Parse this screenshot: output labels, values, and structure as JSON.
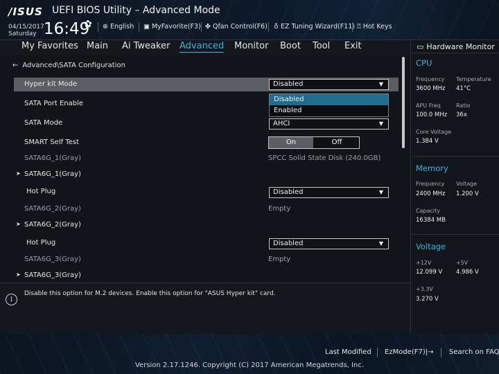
{
  "header": {
    "logo": "/ISUS",
    "title": "UEFI BIOS Utility – Advanced Mode",
    "date": "04/15/2017",
    "day": "Saturday",
    "time": "16:49",
    "tools": [
      {
        "icon": "globe-icon",
        "label": "English"
      },
      {
        "icon": "star-icon",
        "label": "MyFavorite(F3)"
      },
      {
        "icon": "fan-icon",
        "label": "Qfan Control(F6)"
      },
      {
        "icon": "bulb-icon",
        "label": "EZ Tuning Wizard(F11)"
      },
      {
        "icon": "question-icon",
        "label": "Hot Keys"
      }
    ]
  },
  "menu": {
    "tabs": [
      "My Favorites",
      "Main",
      "Ai Tweaker",
      "Advanced",
      "Monitor",
      "Boot",
      "Tool",
      "Exit"
    ],
    "active": "Advanced"
  },
  "breadcrumb": "Advanced\\SATA Configuration",
  "settings": {
    "hyper_kit": {
      "label": "Hyper kit Mode",
      "value": "Disabled"
    },
    "sata_port_enable": {
      "label": "SATA Port Enable"
    },
    "sata_mode": {
      "label": "SATA Mode",
      "value": "AHCI"
    },
    "smart_self_test": {
      "label": "SMART Self Test",
      "on": "On",
      "off": "Off"
    },
    "sata6g_1_info": {
      "label": "SATA6G_1(Gray)",
      "value": "SPCC Solid State Disk (240.0GB)"
    },
    "sata6g_1_sub": {
      "label": "SATA6G_1(Gray)"
    },
    "hot_plug_1": {
      "label": "Hot Plug",
      "value": "Disabled"
    },
    "sata6g_2_info": {
      "label": "SATA6G_2(Gray)",
      "value": "Empty"
    },
    "sata6g_2_sub": {
      "label": "SATA6G_2(Gray)"
    },
    "hot_plug_2": {
      "label": "Hot Plug",
      "value": "Disabled"
    },
    "sata6g_3_info": {
      "label": "SATA6G_3(Gray)",
      "value": "Empty"
    },
    "sata6g_3_sub": {
      "label": "SATA6G_3(Gray)"
    }
  },
  "dropdown_popup": {
    "options": [
      "Disabled",
      "Enabled"
    ],
    "selected": "Disabled"
  },
  "help": {
    "text": "Disable this option for M.2 devices. Enable this option for \"ASUS Hyper kit\" card."
  },
  "hardware_monitor": {
    "title": "Hardware Monitor",
    "cpu": {
      "heading": "CPU",
      "frequency_label": "Frequency",
      "frequency": "3600 MHz",
      "temperature_label": "Temperature",
      "temperature": "41°C",
      "apu_freq_label": "APU Freq",
      "apu_freq": "100.0 MHz",
      "ratio_label": "Ratio",
      "ratio": "36x",
      "core_voltage_label": "Core Voltage",
      "core_voltage": "1.384 V"
    },
    "memory": {
      "heading": "Memory",
      "frequency_label": "Frequency",
      "frequency": "2400 MHz",
      "voltage_label": "Voltage",
      "voltage": "1.200 V",
      "capacity_label": "Capacity",
      "capacity": "16384 MB"
    },
    "voltage": {
      "heading": "Voltage",
      "v12_label": "+12V",
      "v12": "12.099 V",
      "v5_label": "+5V",
      "v5": "4.986 V",
      "v33_label": "+3.3V",
      "v33": "3.270 V"
    }
  },
  "footer": {
    "last_modified": "Last Modified",
    "ezmode": "EzMode(F7)|→",
    "search_faq": "Search on FAQ",
    "copyright": "Version 2.17.1246. Copyright (C) 2017 American Megatrends, Inc."
  },
  "colors": {
    "accent": "#3cb4e6",
    "highlight_row": "#5a5e63",
    "popup_selected": "#1f6c8f"
  }
}
